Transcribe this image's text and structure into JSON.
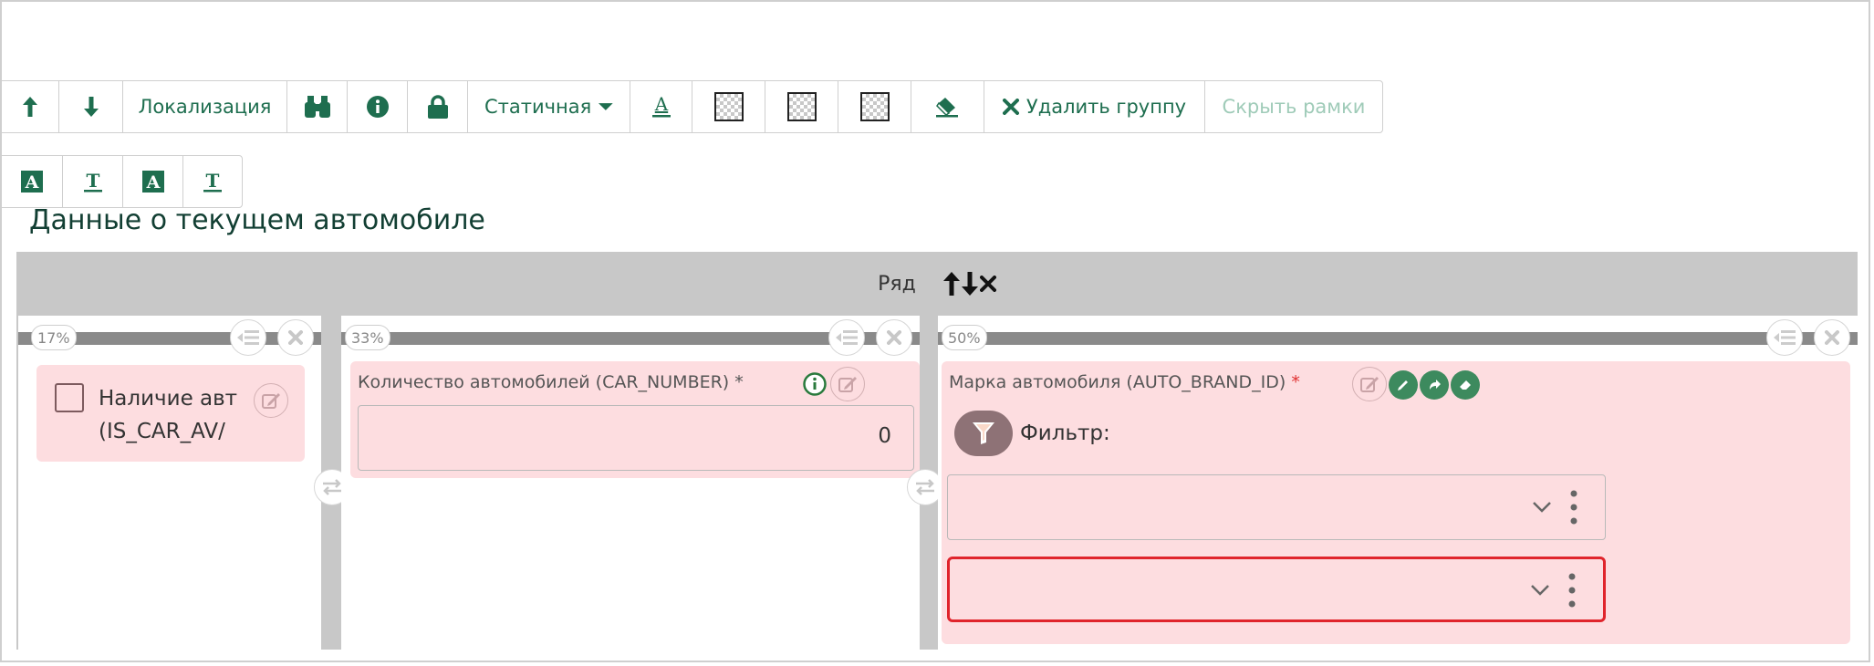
{
  "toolbar": {
    "localization_label": "Локализация",
    "static_label": "Статичная",
    "delete_group_label": "Удалить группу",
    "hide_frames_label": "Скрыть рамки"
  },
  "section": {
    "title": "Данные о текущем автомобиле"
  },
  "row": {
    "label": "Ряд"
  },
  "columns": [
    {
      "width_label": "17%",
      "field": {
        "label_line1": "Наличие авт",
        "label_line2": "(IS_CAR_AV/",
        "checked": false
      }
    },
    {
      "width_label": "33%",
      "field": {
        "label": "Количество автомобилей (CAR_NUMBER)",
        "required_mark": "*",
        "value": "0"
      }
    },
    {
      "width_label": "50%",
      "field": {
        "label": "Марка автомобиля (AUTO_BRAND_ID)",
        "required_mark": "*",
        "filter_label": "Фильтр:"
      }
    }
  ],
  "colors": {
    "accent": "#1e6e4f",
    "field_bg": "#fddde0",
    "error_border": "#e0242c",
    "row_bg": "#c8c8c8",
    "column_bar": "#8a8a8a"
  },
  "icons": [
    "arrow-up-icon",
    "arrow-down-icon",
    "binoculars-icon",
    "info-icon",
    "lock-icon",
    "caret-down-icon",
    "text-color-icon",
    "transparency-icon",
    "eraser-icon",
    "close-icon",
    "menu-icon",
    "edit-icon",
    "swap-icon",
    "filter-icon",
    "chevron-down-icon",
    "more-vertical-icon",
    "pencil-icon",
    "share-icon"
  ]
}
